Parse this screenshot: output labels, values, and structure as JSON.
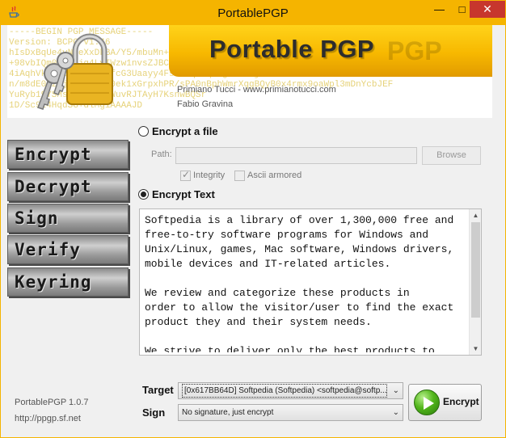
{
  "window": {
    "title": "PortablePGP",
    "minimize": "—",
    "maximize": "□",
    "close": "✕"
  },
  "banner": {
    "app_name": "Portable PGP",
    "ghost": "PGP",
    "pgp_block": "-----BEGIN PGP MESSAGE-----\nVersion: BCPG v1.46\nhIsDxBqUe4yN3eXxDkBA/Y5/mbuMn+f1drbhTx0Wqs0HM+8ZxUO1bJwbLgr8Uzwa\n+98vbIQm0e6yhjg4LvIWzw1nvsZJBClxp4i/kAMWh9v+2bQeM2PM+pJMZ0YY8lPsktMN9tQ\n4iAqhVk3JEC5Gxx3zMmfcG3Uaayy4Fs7Clqs+qvLg6Yr69j6l+HeRKxThuuMe94GBkIvXG\nn/m8dE0B2YjwSuf5sdO0ek1xGrpxhPR/sPA0nBphWmrXqgBQyB0x4rmx9oaWpl3mDnYcbJEF\nYuRyb19YSMsWDKJmbaXWuvRJTAyH7KsnwBQSr\n1D/Sc9l4HqdSG+dlMgiAAAAJD",
    "credit_line1": "Primiano Tucci - www.primianotucci.com",
    "credit_line2": "Fabio Gravina"
  },
  "nav": {
    "items": [
      {
        "label": "Encrypt"
      },
      {
        "label": "Decrypt"
      },
      {
        "label": "Sign"
      },
      {
        "label": "Verify"
      },
      {
        "label": "Keyring"
      }
    ]
  },
  "footer": {
    "version": "PortablePGP  1.0.7",
    "url": "http://ppgp.sf.net"
  },
  "form": {
    "encrypt_file_label": "Encrypt a file",
    "path_label": "Path:",
    "path_value": "",
    "browse_label": "Browse",
    "integrity_label": "Integrity",
    "ascii_label": "Ascii armored",
    "encrypt_text_label": "Encrypt Text",
    "text_content": "Softpedia is a library of over 1,300,000 free and\nfree-to-try software programs for Windows and\nUnix/Linux, games, Mac software, Windows drivers,\nmobile devices and IT-related articles.\n\nWe review and categorize these products in\norder to allow the visitor/user to find the exact\nproduct they and their system needs.\n\nWe strive to deliver only the best products to",
    "target_label": "Target",
    "target_value": "[0x617BB64D] Softpedia (Softpedia) <softpedia@softp...",
    "sign_label": "Sign",
    "sign_value": "No signature, just encrypt",
    "encrypt_button": "Encrypt"
  },
  "colors": {
    "title_bar": "#f5b400",
    "close_button": "#c7362d",
    "encrypt_icon": "#52b61b"
  }
}
